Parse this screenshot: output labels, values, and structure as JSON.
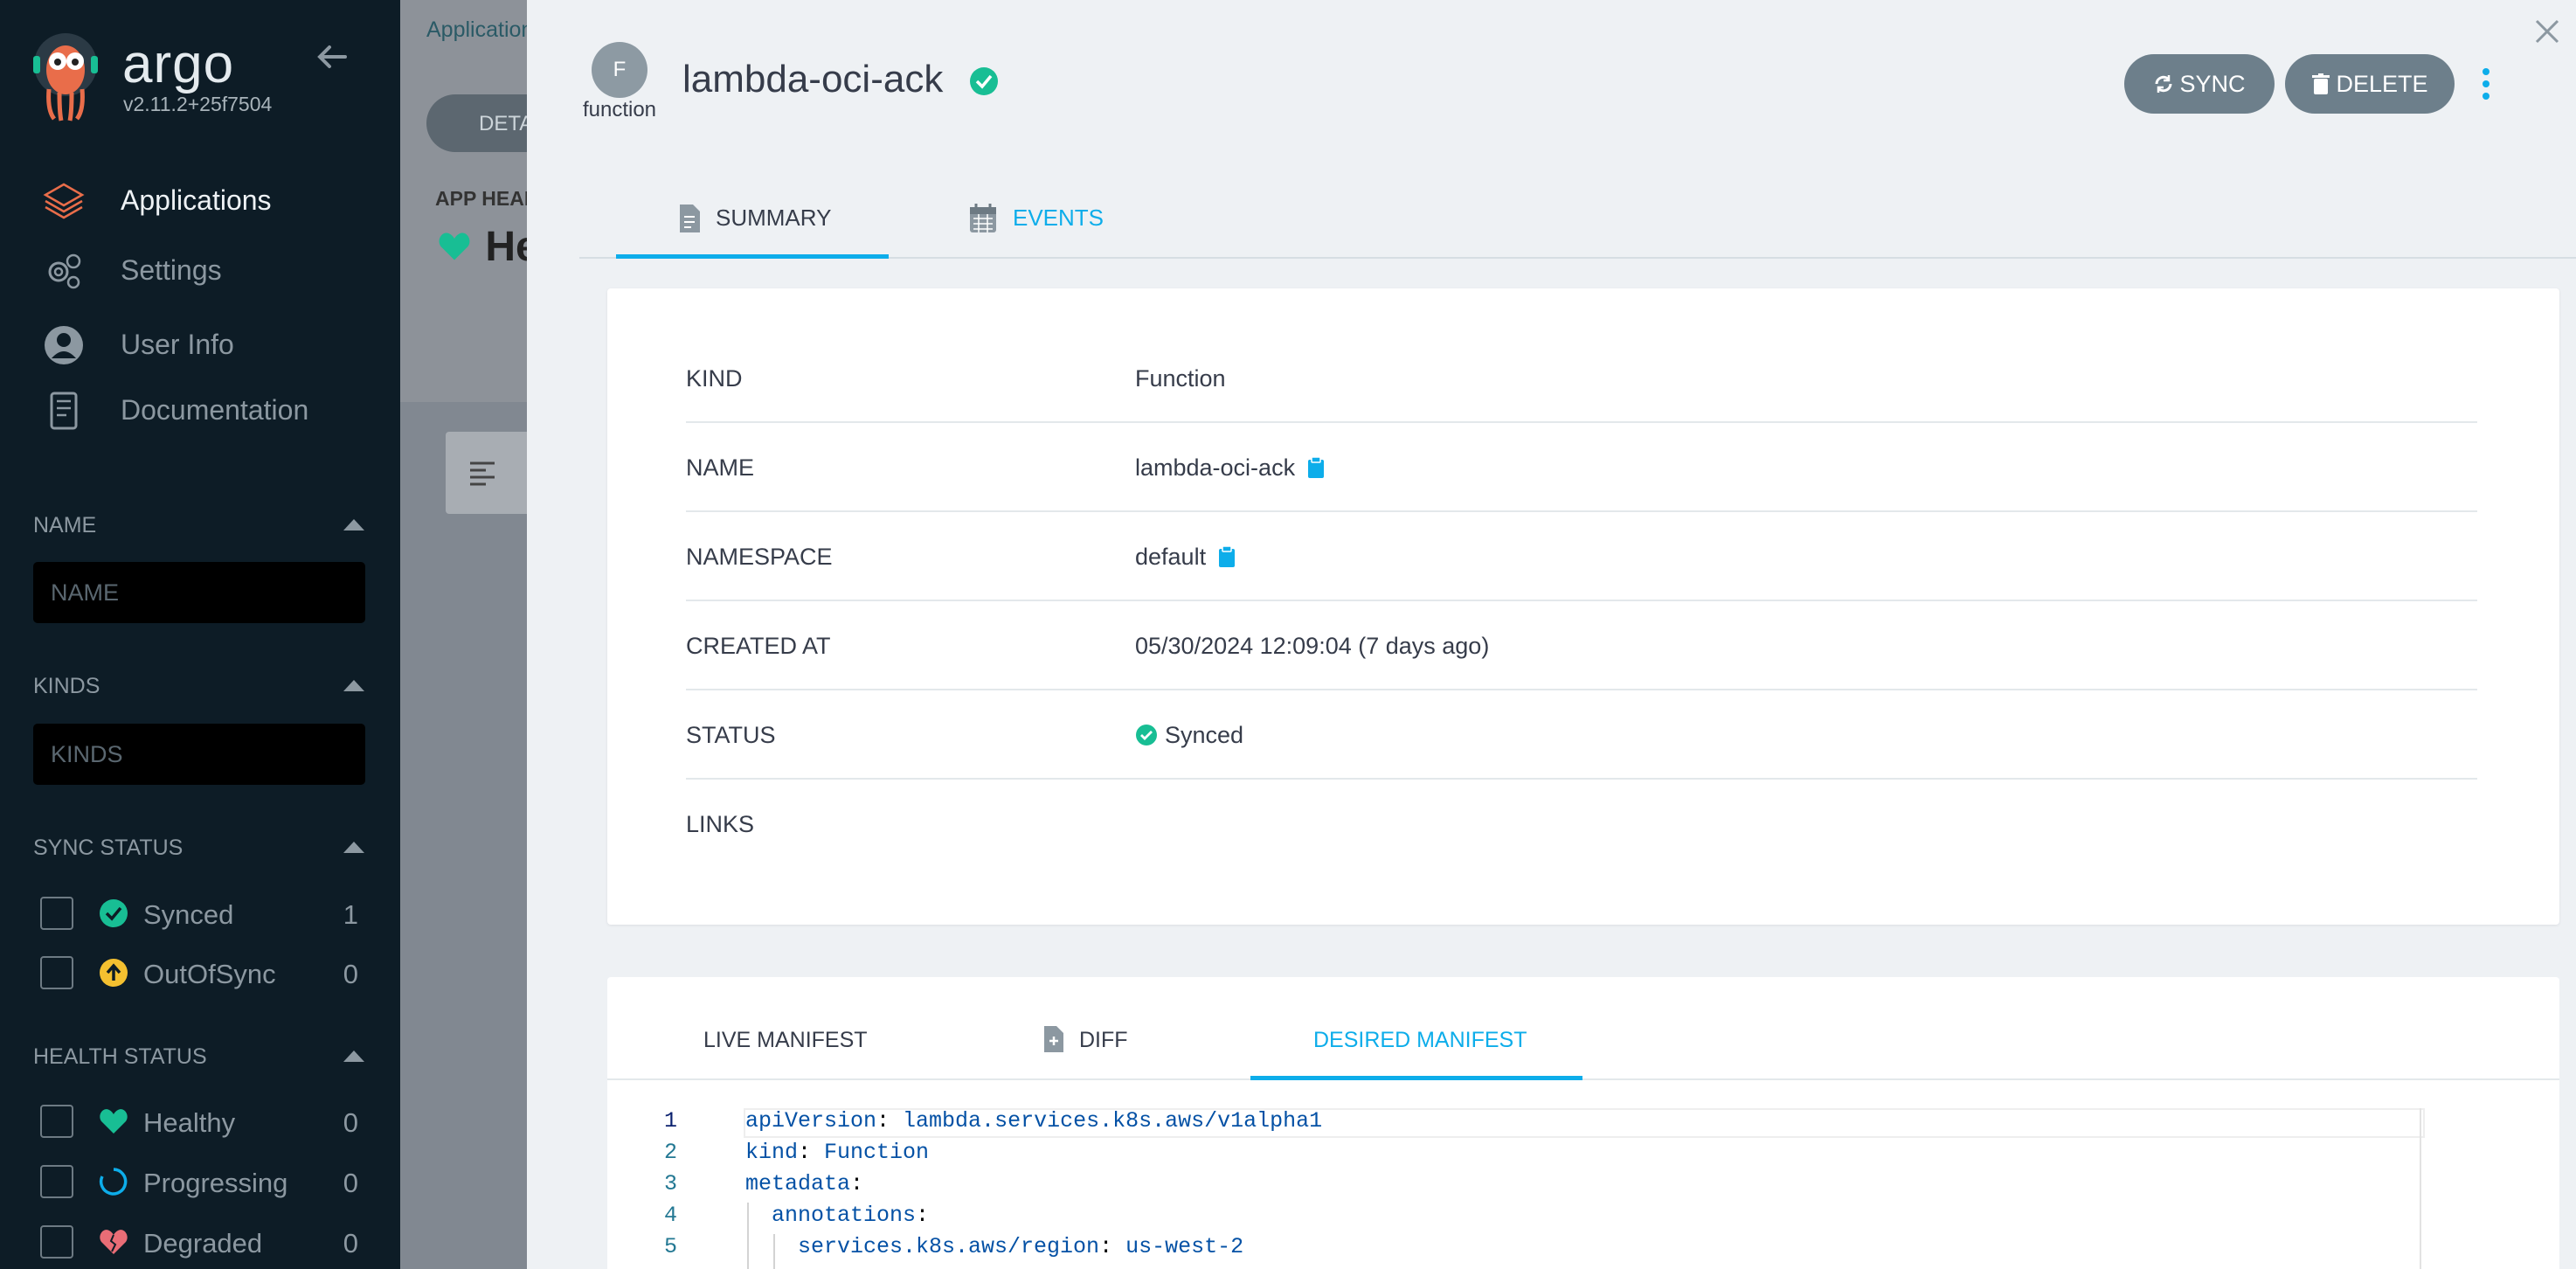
{
  "sidebar": {
    "brand": "argo",
    "version": "v2.11.2+25f7504",
    "nav": [
      {
        "label": "Applications",
        "icon": "layers-icon",
        "active": true
      },
      {
        "label": "Settings",
        "icon": "gears-icon"
      },
      {
        "label": "User Info",
        "icon": "user-circle-icon"
      },
      {
        "label": "Documentation",
        "icon": "book-icon"
      }
    ],
    "filters": {
      "name": {
        "title": "NAME",
        "placeholder": "NAME"
      },
      "kinds": {
        "title": "KINDS",
        "placeholder": "KINDS"
      },
      "sync_status": {
        "title": "SYNC STATUS",
        "items": [
          {
            "label": "Synced",
            "count": "1",
            "color": "#18be94"
          },
          {
            "label": "OutOfSync",
            "count": "0",
            "color": "#f4c030"
          }
        ]
      },
      "health_status": {
        "title": "HEALTH STATUS",
        "items": [
          {
            "label": "Healthy",
            "count": "0",
            "color": "#18be94"
          },
          {
            "label": "Progressing",
            "count": "0",
            "color": "#0dadea"
          },
          {
            "label": "Degraded",
            "count": "0",
            "color": "#e96d76"
          }
        ]
      }
    }
  },
  "background": {
    "breadcrumb": "Applications",
    "details_btn": "DETAILS",
    "app_health_label": "APP HEALTH",
    "health_value": "Healthy"
  },
  "panel": {
    "avatar_letter": "F",
    "avatar_label": "function",
    "title": "lambda-oci-ack",
    "sync_btn": "SYNC",
    "delete_btn": "DELETE",
    "tabs": [
      {
        "label": "SUMMARY",
        "active": true
      },
      {
        "label": "EVENTS",
        "active": false
      }
    ],
    "summary": [
      {
        "key": "KIND",
        "value": "Function"
      },
      {
        "key": "NAME",
        "value": "lambda-oci-ack",
        "copy": true
      },
      {
        "key": "NAMESPACE",
        "value": "default",
        "copy": true
      },
      {
        "key": "CREATED AT",
        "value": "05/30/2024 12:09:04  (7 days ago)"
      },
      {
        "key": "STATUS",
        "value": "Synced"
      },
      {
        "key": "LINKS",
        "value": ""
      }
    ],
    "manifest_tabs": [
      {
        "label": "LIVE MANIFEST",
        "active": false
      },
      {
        "label": "DIFF",
        "active": false
      },
      {
        "label": "DESIRED MANIFEST",
        "active": true
      }
    ],
    "code": [
      {
        "n": "1",
        "k": "apiVersion",
        "v": "lambda.services.k8s.aws/v1alpha1",
        "indent": 0
      },
      {
        "n": "2",
        "k": "kind",
        "v": "Function",
        "indent": 0
      },
      {
        "n": "3",
        "k": "metadata",
        "v": "",
        "indent": 0
      },
      {
        "n": "4",
        "k": "annotations",
        "v": "",
        "indent": 1
      },
      {
        "n": "5",
        "k": "services.k8s.aws/region",
        "v": "us-west-2",
        "indent": 2
      }
    ]
  },
  "colors": {
    "accent": "#0dadea",
    "synced": "#18be94",
    "sidebar_bg": "#0d1c26",
    "button": "#6d7f8b"
  }
}
